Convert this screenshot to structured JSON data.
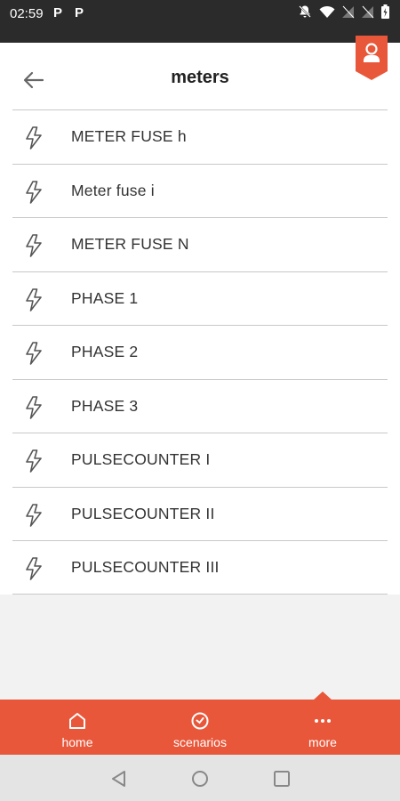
{
  "status_bar": {
    "time": "02:59",
    "p1": "P",
    "p2": "P"
  },
  "header": {
    "title": "meters"
  },
  "meters": [
    {
      "label": "METER FUSE h"
    },
    {
      "label": "Meter fuse i"
    },
    {
      "label": "METER FUSE N"
    },
    {
      "label": "PHASE 1"
    },
    {
      "label": "PHASE 2"
    },
    {
      "label": "PHASE 3"
    },
    {
      "label": "PULSECOUNTER I"
    },
    {
      "label": "PULSECOUNTER II"
    },
    {
      "label": "PULSECOUNTER III"
    }
  ],
  "bottom_nav": {
    "home": "home",
    "scenarios": "scenarios",
    "more": "more",
    "active": "more"
  },
  "colors": {
    "accent": "#e8573a",
    "status_bar": "#2b2b2b",
    "background": "#f2f2f2"
  }
}
